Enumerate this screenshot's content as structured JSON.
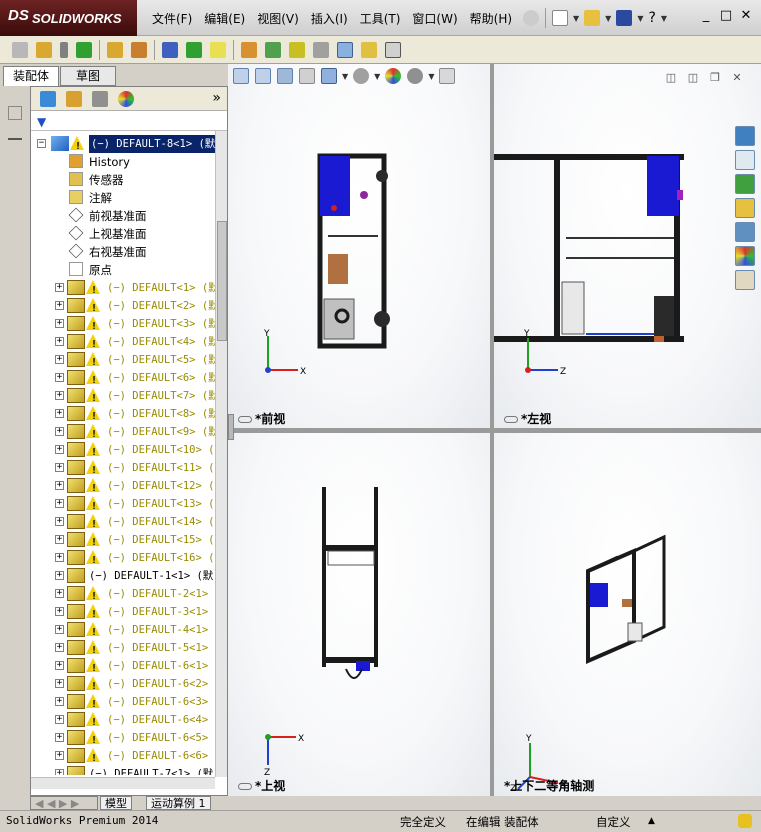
{
  "app": {
    "logo_prefix": "DS",
    "logo_text": "SOLIDWORKS"
  },
  "menu": [
    "文件(F)",
    "编辑(E)",
    "视图(V)",
    "插入(I)",
    "工具(T)",
    "窗口(W)",
    "帮助(H)"
  ],
  "window_controls": {
    "minimize": "_",
    "restore": "□",
    "close": "✕",
    "help": "?"
  },
  "manager_tabs": {
    "assembly": "装配体",
    "sketch": "草图"
  },
  "panel": {
    "expand": "»"
  },
  "tree": {
    "root": "(−) DEFAULT-8<1> (默",
    "features": [
      {
        "label": "History",
        "icon": "history-icon"
      },
      {
        "label": "传感器",
        "icon": "sensor-icon"
      },
      {
        "label": "注解",
        "icon": "annotation-icon"
      },
      {
        "label": "前视基准面",
        "icon": "plane-icon"
      },
      {
        "label": "上视基准面",
        "icon": "plane-icon"
      },
      {
        "label": "右视基准面",
        "icon": "plane-icon"
      },
      {
        "label": "原点",
        "icon": "origin-icon"
      }
    ],
    "components": [
      {
        "label": "(−) DEFAULT<1> (默",
        "style": "yellow",
        "warn": true
      },
      {
        "label": "(−) DEFAULT<2> (默",
        "style": "yellow",
        "warn": true
      },
      {
        "label": "(−) DEFAULT<3> (默",
        "style": "yellow",
        "warn": true
      },
      {
        "label": "(−) DEFAULT<4> (默",
        "style": "yellow",
        "warn": true
      },
      {
        "label": "(−) DEFAULT<5> (默",
        "style": "yellow",
        "warn": true
      },
      {
        "label": "(−) DEFAULT<6> (默",
        "style": "yellow",
        "warn": true
      },
      {
        "label": "(−) DEFAULT<7> (默",
        "style": "yellow",
        "warn": true
      },
      {
        "label": "(−) DEFAULT<8> (默",
        "style": "yellow",
        "warn": true
      },
      {
        "label": "(−) DEFAULT<9> (默",
        "style": "yellow",
        "warn": true
      },
      {
        "label": "(−) DEFAULT<10> (",
        "style": "yellow",
        "warn": true
      },
      {
        "label": "(−) DEFAULT<11> (",
        "style": "yellow",
        "warn": true
      },
      {
        "label": "(−) DEFAULT<12> (",
        "style": "yellow",
        "warn": true
      },
      {
        "label": "(−) DEFAULT<13> (",
        "style": "yellow",
        "warn": true
      },
      {
        "label": "(−) DEFAULT<14> (",
        "style": "yellow",
        "warn": true
      },
      {
        "label": "(−) DEFAULT<15> (",
        "style": "yellow",
        "warn": true
      },
      {
        "label": "(−) DEFAULT<16> (",
        "style": "yellow",
        "warn": true
      },
      {
        "label": "(−) DEFAULT-1<1> (默",
        "style": "black",
        "warn": false
      },
      {
        "label": "(−) DEFAULT-2<1>",
        "style": "yellow",
        "warn": true
      },
      {
        "label": "(−) DEFAULT-3<1>",
        "style": "yellow",
        "warn": true
      },
      {
        "label": "(−) DEFAULT-4<1>",
        "style": "yellow",
        "warn": true
      },
      {
        "label": "(−) DEFAULT-5<1>",
        "style": "yellow",
        "warn": true
      },
      {
        "label": "(−) DEFAULT-6<1>",
        "style": "yellow",
        "warn": true
      },
      {
        "label": "(−) DEFAULT-6<2>",
        "style": "yellow",
        "warn": true
      },
      {
        "label": "(−) DEFAULT-6<3>",
        "style": "yellow",
        "warn": true
      },
      {
        "label": "(−) DEFAULT-6<4>",
        "style": "yellow",
        "warn": true
      },
      {
        "label": "(−) DEFAULT-6<5>",
        "style": "yellow",
        "warn": true
      },
      {
        "label": "(−) DEFAULT-6<6>",
        "style": "yellow",
        "warn": true
      },
      {
        "label": "(−) DEFAULT-7<1> (默",
        "style": "black",
        "warn": false
      }
    ]
  },
  "bottom_tabs": {
    "model": "模型",
    "motion": "运动算例 1"
  },
  "viewports": {
    "front": "*前视",
    "left": "*左视",
    "top": "*上视",
    "iso": "*上下二等角轴测"
  },
  "axes": {
    "x": "X",
    "y": "Y",
    "z": "Z"
  },
  "status": {
    "app_version": "SolidWorks Premium 2014",
    "definition": "完全定义",
    "mode": "在编辑 装配体",
    "units": "自定义",
    "arrow": "▲"
  },
  "colors": {
    "blue_part": "#1a1ad2",
    "frame": "#1a1a1a",
    "x_axis": "#d62020",
    "y_axis": "#20a020",
    "z_axis": "#2040d0",
    "warning": "#f3d20a"
  }
}
